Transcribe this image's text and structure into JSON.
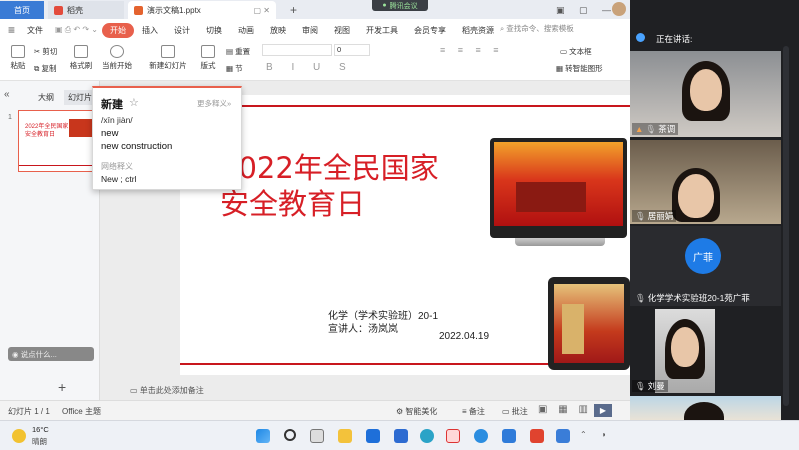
{
  "tabs": {
    "home": "首页",
    "daoke": "稻壳",
    "document": "演示文稿1.pptx"
  },
  "meeting_pill": "腾讯会议",
  "ribbon": {
    "file": "文件",
    "tabs": [
      "开始",
      "插入",
      "设计",
      "切换",
      "动画",
      "放映",
      "审阅",
      "视图",
      "开发工具",
      "会员专享",
      "稻壳资源"
    ],
    "search_placeholder": "查找命令、搜索模板"
  },
  "toolbar": {
    "paste": "粘贴",
    "cut": "剪切",
    "copy": "复制",
    "format_painter": "格式刷",
    "play_from_current": "当前开始",
    "new_slide": "新建幻灯片",
    "layout": "版式",
    "section": "节",
    "reset": "重置",
    "font_size": "0",
    "text_box": "文本框",
    "smart_shape": "转智能图形"
  },
  "left_panel": {
    "outline_tab": "大纲",
    "slides_tab": "幻灯片",
    "thumb_number": "1",
    "thumb_title": "2022年全民国家安全教育日",
    "add_button": "+",
    "chat_placeholder": "说点什么..."
  },
  "slide": {
    "title_line1": "2022年全民国家",
    "title_line2": "安全教育日",
    "subject": "化学（学术实验班）20-1",
    "speaker": "宣讲人：汤岚岚",
    "date": "2022.04.19"
  },
  "popup": {
    "word": "新建",
    "more": "更多释义»",
    "pinyin": "/xīn jiàn/",
    "def1": "new",
    "def2": "new construction",
    "web_header": "网络释义",
    "web_def": "New ; ctrl"
  },
  "notes_placeholder": "单击此处添加备注",
  "status": {
    "slide_count": "幻灯片 1 / 1",
    "theme": "Office 主题",
    "beautify": "智能美化",
    "notes": "备注",
    "comments": "批注"
  },
  "taskbar": {
    "temperature": "16°C",
    "weather": "晴朗"
  },
  "video": {
    "speaking_label": "正在讲话:",
    "participants": [
      {
        "name": "茶调"
      },
      {
        "name": "居丽娟"
      },
      {
        "name": "化学学术实验班20-1苑广菲",
        "avatar": "广菲"
      },
      {
        "name": "刘曼"
      }
    ]
  },
  "colors": {
    "accent": "#e8604c",
    "slide_red": "#d71f26",
    "avatar_blue": "#1e7be6"
  }
}
